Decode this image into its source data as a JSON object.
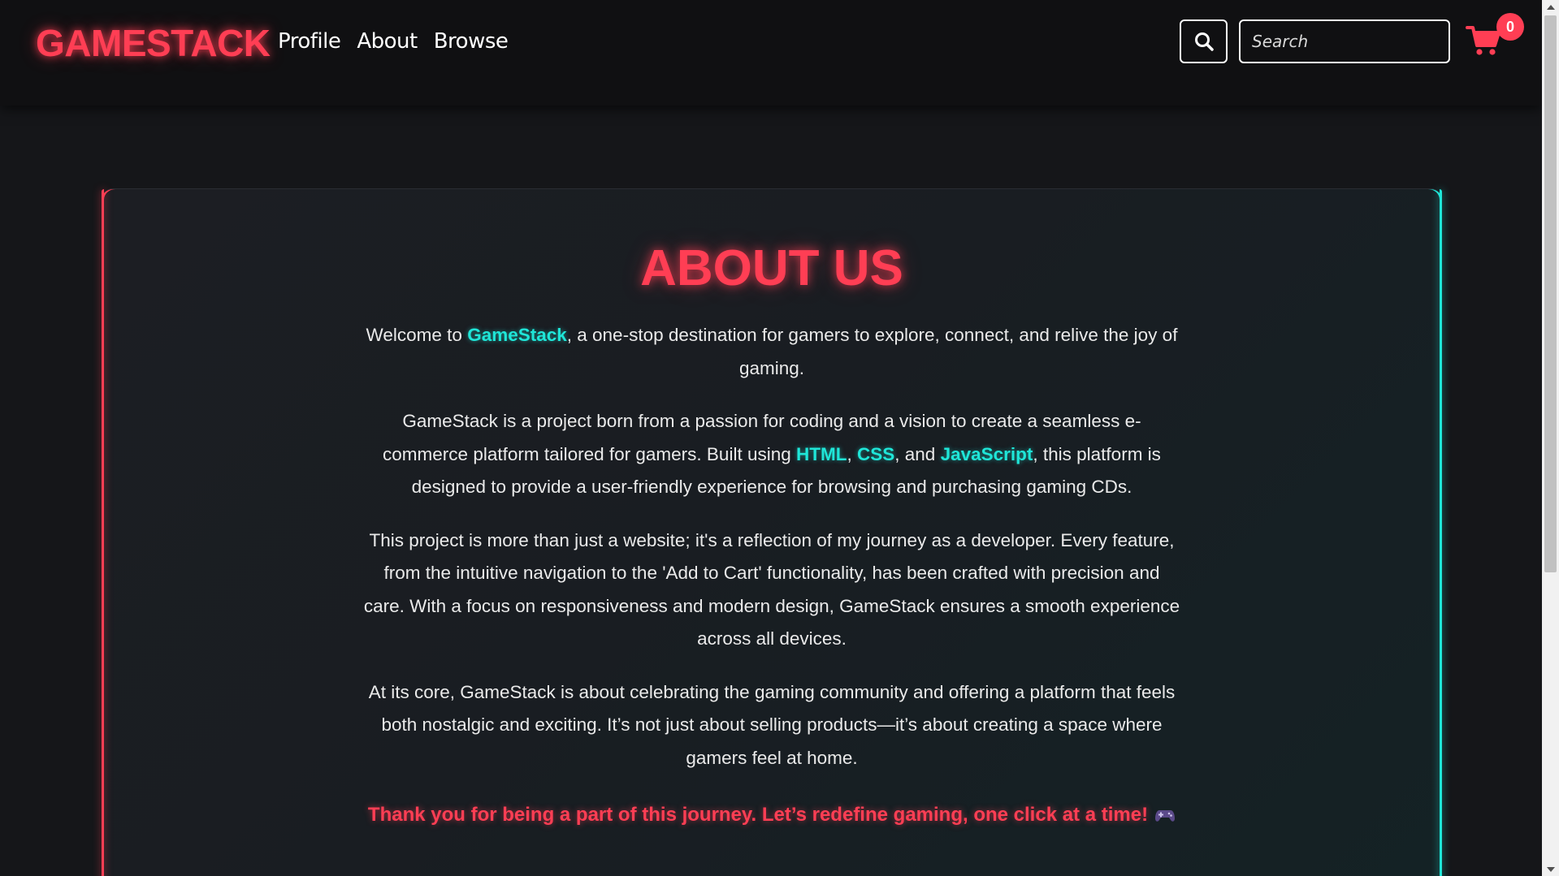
{
  "header": {
    "logo": "GAMESTACK",
    "nav": [
      {
        "label": "Profile"
      },
      {
        "label": "About"
      },
      {
        "label": "Browse"
      }
    ],
    "search": {
      "placeholder": "Search",
      "button_icon": "search-icon"
    },
    "cart": {
      "icon": "cart-icon",
      "count": "0"
    }
  },
  "about": {
    "title": "ABOUT US",
    "p1": {
      "before": "Welcome to ",
      "highlight": "GameStack",
      "after": ", a one-stop destination for gamers to explore, connect, and relive the joy of gaming."
    },
    "p2": {
      "before": "GameStack is a project born from a passion for coding and a vision to create a seamless e-commerce platform tailored for gamers. Built using ",
      "tech1": "HTML",
      "sep1": ", ",
      "tech2": "CSS",
      "sep2": ", and ",
      "tech3": "JavaScript",
      "after": ", this platform is designed to provide a user-friendly experience for browsing and purchasing gaming CDs."
    },
    "p3": "This project is more than just a website; it's a reflection of my journey as a developer. Every feature, from the intuitive navigation to the 'Add to Cart' functionality, has been crafted with precision and care. With a focus on responsiveness and modern design, GameStack ensures a smooth experience across all devices.",
    "p4": "At its core, GameStack is about celebrating the gaming community and offering a platform that feels both nostalgic and exciting. It’s not just about selling products—it’s about creating a space where gamers feel at home.",
    "thanks": "Thank you for being a part of this journey. Let’s redefine gaming, one click at a time!",
    "thanks_icon": "gamepad-icon"
  },
  "colors": {
    "accent_red": "#ff3e54",
    "accent_cyan": "#1fe6d8",
    "background": "#151619",
    "header_bg": "#101012"
  }
}
